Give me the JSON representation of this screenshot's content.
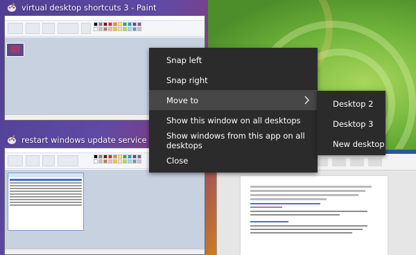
{
  "windows": [
    {
      "title": "virtual desktop shortcuts 3 - Paint"
    },
    {
      "title": "restart windows update service - Paint"
    }
  ],
  "context_menu": {
    "items": [
      {
        "label": "Snap left"
      },
      {
        "label": "Snap right"
      },
      {
        "label": "Move to",
        "has_submenu": true,
        "highlighted": true
      },
      {
        "label": "Show this window on all desktops"
      },
      {
        "label": "Show windows from this app on all desktops"
      },
      {
        "label": "Close"
      }
    ]
  },
  "submenu": {
    "items": [
      {
        "label": "Desktop 2"
      },
      {
        "label": "Desktop 3"
      },
      {
        "label": "New desktop"
      }
    ]
  },
  "colors": {
    "menu_bg": "#2b2b2b",
    "menu_highlight": "#474747",
    "menu_text": "#ffffff"
  },
  "icons": [
    "paint-icon",
    "chevron-right-icon"
  ]
}
